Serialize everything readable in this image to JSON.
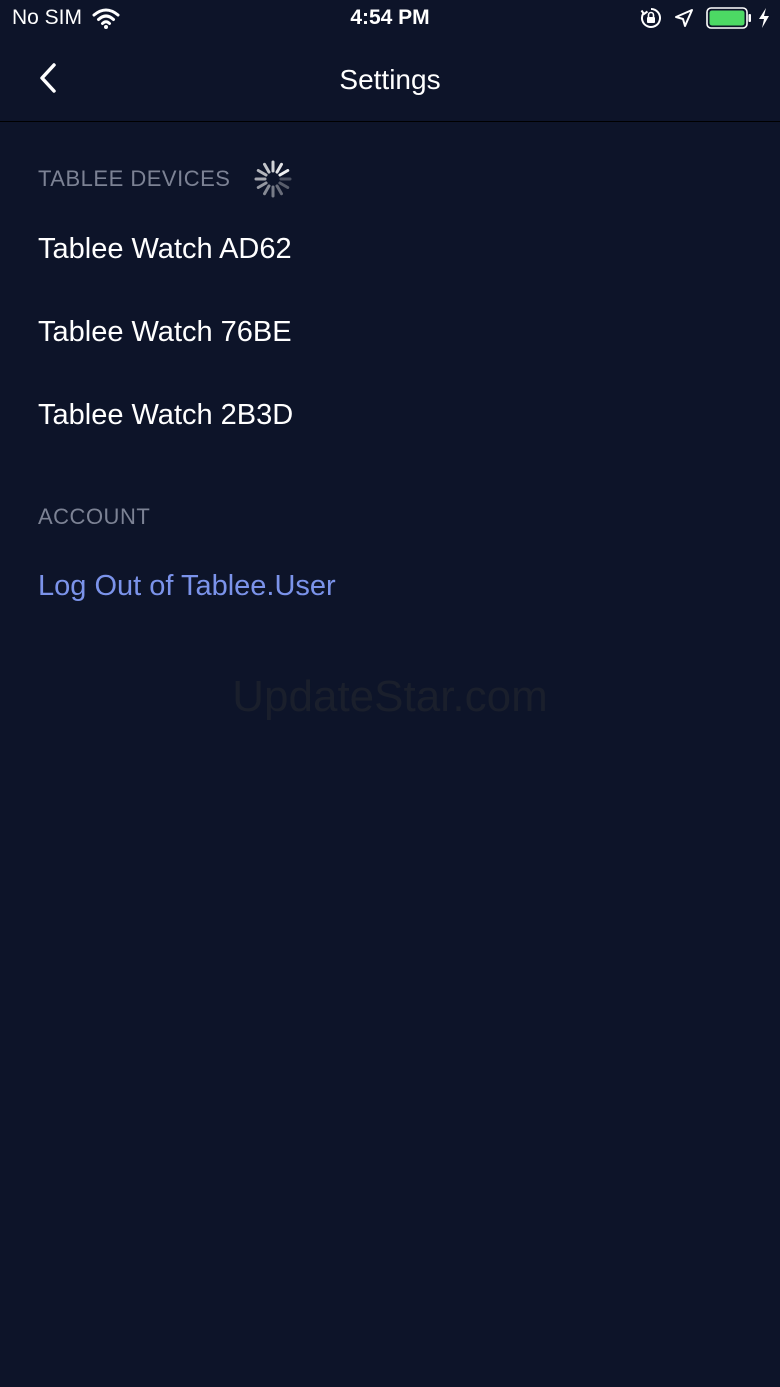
{
  "status_bar": {
    "carrier": "No SIM",
    "time": "4:54 PM",
    "battery_color": "#4cd964"
  },
  "nav": {
    "title": "Settings"
  },
  "sections": {
    "devices": {
      "header": "TABLEE DEVICES",
      "items": [
        {
          "label": "Tablee Watch AD62"
        },
        {
          "label": "Tablee Watch 76BE"
        },
        {
          "label": "Tablee Watch 2B3D"
        }
      ]
    },
    "account": {
      "header": "ACCOUNT",
      "logout_label": "Log Out of Tablee.User"
    }
  },
  "watermark": "UpdateStar.com",
  "colors": {
    "background": "#0d1429",
    "link": "#7b93ea",
    "section_header": "#7c8294"
  }
}
